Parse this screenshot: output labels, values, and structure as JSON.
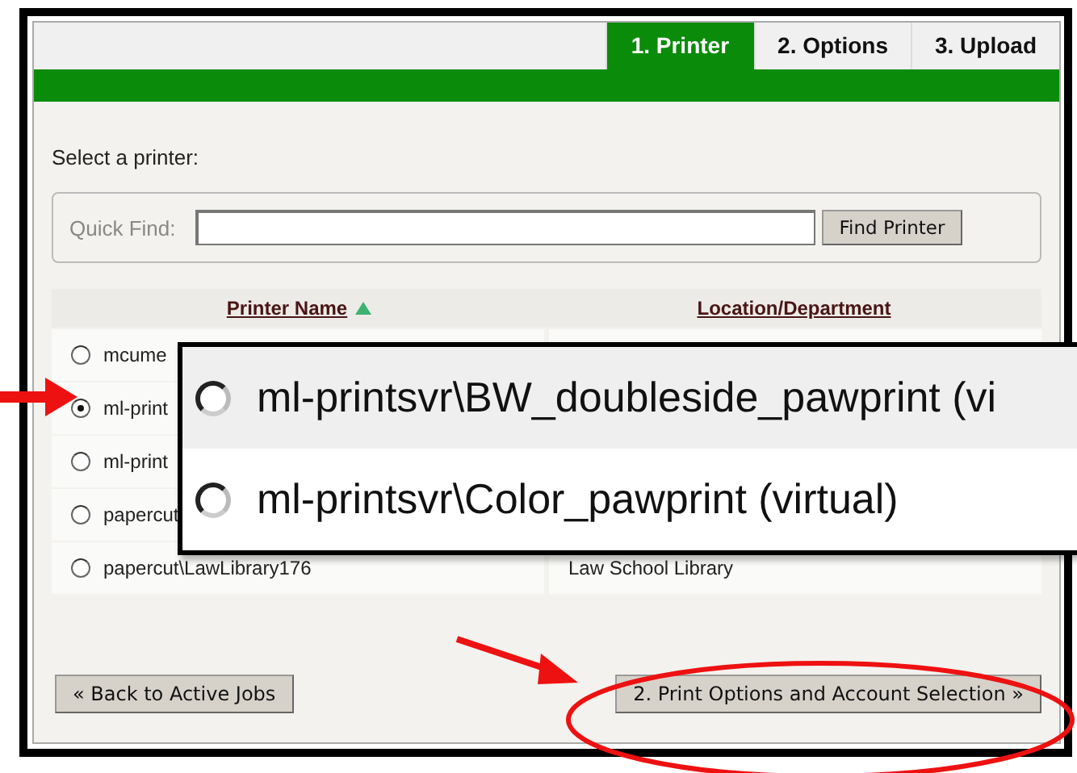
{
  "tabs": [
    {
      "label": "1. Printer",
      "selected": true
    },
    {
      "label": "2. Options",
      "selected": false
    },
    {
      "label": "3. Upload",
      "selected": false
    }
  ],
  "instruction": "Select a printer:",
  "quick_find": {
    "label": "Quick Find:",
    "button": "Find Printer"
  },
  "table": {
    "columns": [
      {
        "label": "Printer Name",
        "sorted": true
      },
      {
        "label": "Location/Department"
      }
    ],
    "rows": [
      {
        "name": "mcume",
        "selected": false
      },
      {
        "name": "ml-print",
        "selected": true
      },
      {
        "name": "ml-print",
        "selected": false
      },
      {
        "name": "papercut",
        "selected": false
      },
      {
        "name": "papercut\\LawLibrary176",
        "location": "Law School Library",
        "selected": false
      }
    ]
  },
  "zoom_callout": {
    "rows": [
      {
        "name": "ml-printsvr\\BW_doubleside_pawprint (vi",
        "selected": false
      },
      {
        "name": "ml-printsvr\\Color_pawprint (virtual)",
        "selected": false
      }
    ]
  },
  "buttons": {
    "back": "« Back to Active Jobs",
    "next": "2. Print Options and Account Selection »"
  }
}
